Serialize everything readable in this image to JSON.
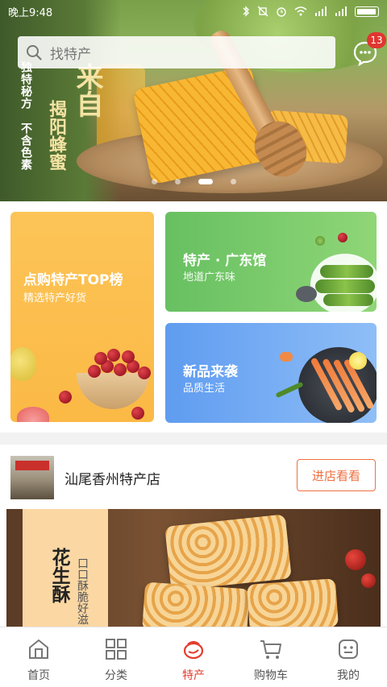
{
  "status_bar": {
    "time": "晚上9:48"
  },
  "hero": {
    "slogan_1": "独特秘方",
    "slogan_2": "不含色素",
    "title_1": "来自",
    "title_2": "揭阳蜂蜜",
    "carousel_total": 4,
    "carousel_active_index": 2
  },
  "search": {
    "placeholder": "找特产"
  },
  "messages": {
    "badge_count": "13"
  },
  "promo_cards": [
    {
      "title": "点购特产TOP榜",
      "subtitle": "精选特产好货"
    },
    {
      "title": "特产 · 广东馆",
      "subtitle": "地道广东味"
    },
    {
      "title": "新品来袭",
      "subtitle": "品质生活"
    }
  ],
  "store": {
    "name": "汕尾香州特产店",
    "enter_button": "进店看看",
    "banner_title": "花生酥",
    "banner_subtitle": "口口酥脆好滋"
  },
  "tabbar": {
    "items": [
      {
        "label": "首页",
        "icon": "home-icon"
      },
      {
        "label": "分类",
        "icon": "category-grid-icon"
      },
      {
        "label": "特产",
        "icon": "specialty-icon"
      },
      {
        "label": "购物车",
        "icon": "cart-icon"
      },
      {
        "label": "我的",
        "icon": "profile-icon"
      }
    ],
    "active_index": 2
  },
  "colors": {
    "accent": "#e53c2e",
    "card_orange": "#fbb945",
    "card_green": "#67c061",
    "card_blue": "#5f9cf0",
    "badge_red": "#e0362f"
  }
}
